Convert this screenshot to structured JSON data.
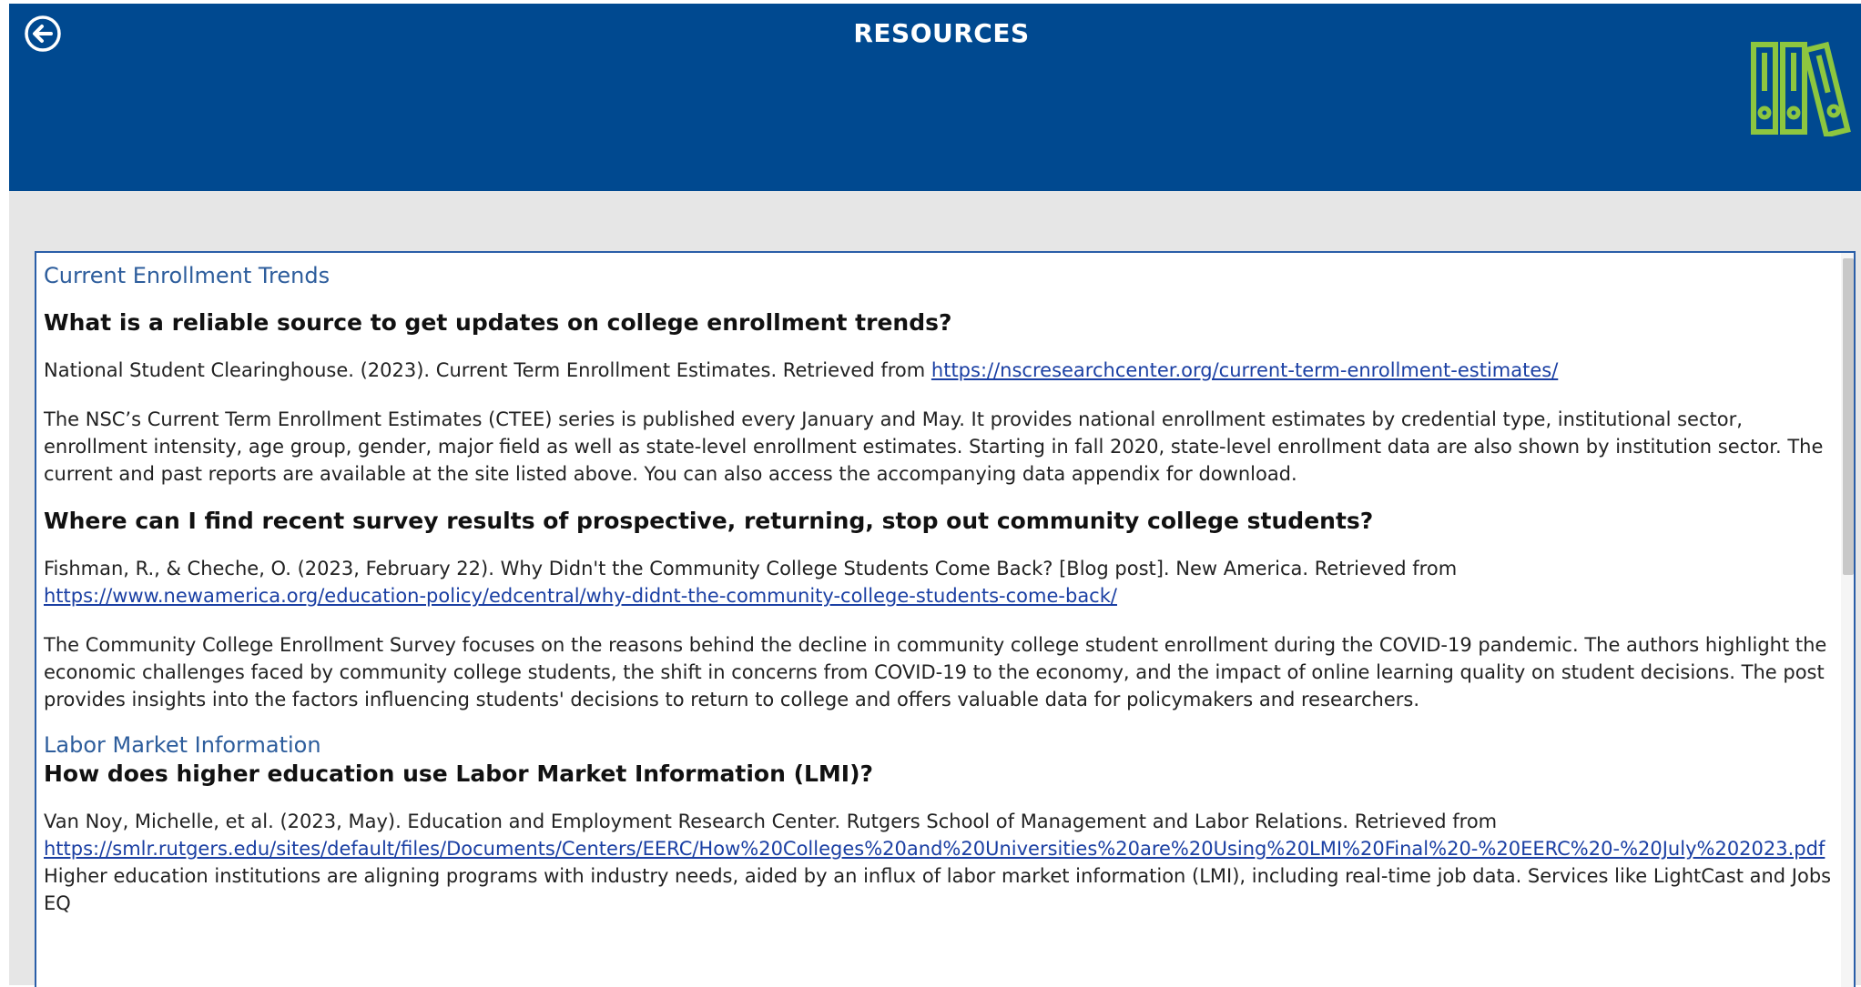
{
  "header": {
    "title": "RESOURCES",
    "bg_color": "#004990",
    "accent_color": "#8dc63f"
  },
  "sections": {
    "enrollment_title": "Current Enrollment Trends",
    "q1": "What is a reliable source to get updates on college enrollment trends?",
    "q1_cite": "National Student Clearinghouse. (2023). Current Term Enrollment Estimates. Retrieved from ",
    "q1_link": "https://nscresearchcenter.org/current-term-enrollment-estimates/",
    "q1_body": "The NSC’s Current Term Enrollment Estimates (CTEE) series is published every January and May. It provides national enrollment estimates by credential type, institutional sector, enrollment intensity, age group, gender, major field as well as state-level enrollment estimates. Starting in fall 2020, state-level enrollment data are also shown by institution sector. The current and past reports are available at the site listed above. You can also access the accompanying data appendix for download.",
    "q2": "Where can I find recent survey results of prospective, returning, stop out community college students?",
    "q2_cite": "Fishman, R., & Cheche, O. (2023, February 22). Why Didn't the Community College Students Come Back? [Blog post]. New America. Retrieved from ",
    "q2_link": "https://www.newamerica.org/education-policy/edcentral/why-didnt-the-community-college-students-come-back/",
    "q2_body": "The Community College Enrollment Survey focuses on the reasons behind the decline in community college student enrollment during the COVID-19 pandemic. The authors highlight the economic challenges faced by community college students, the shift in concerns from COVID-19 to the economy, and the impact of online learning quality on student decisions. The post provides insights into the factors influencing students' decisions to return to college and offers valuable data for policymakers and researchers.",
    "lmi_title": "Labor Market Information",
    "q3": "How does higher education use Labor Market Information (LMI)?",
    "q3_cite": "Van Noy, Michelle, et al. (2023, May). Education and Employment Research Center. Rutgers School of Management and Labor Relations. Retrieved from ",
    "q3_link": "https://smlr.rutgers.edu/sites/default/files/Documents/Centers/EERC/How%20Colleges%20and%20Universities%20are%20Using%20LMI%20Final%20-%20EERC%20-%20July%202023.pdf",
    "q3_body": "Higher education institutions are aligning programs with industry needs, aided by an influx of labor market information (LMI), including real-time job data. Services like LightCast and Jobs EQ"
  }
}
